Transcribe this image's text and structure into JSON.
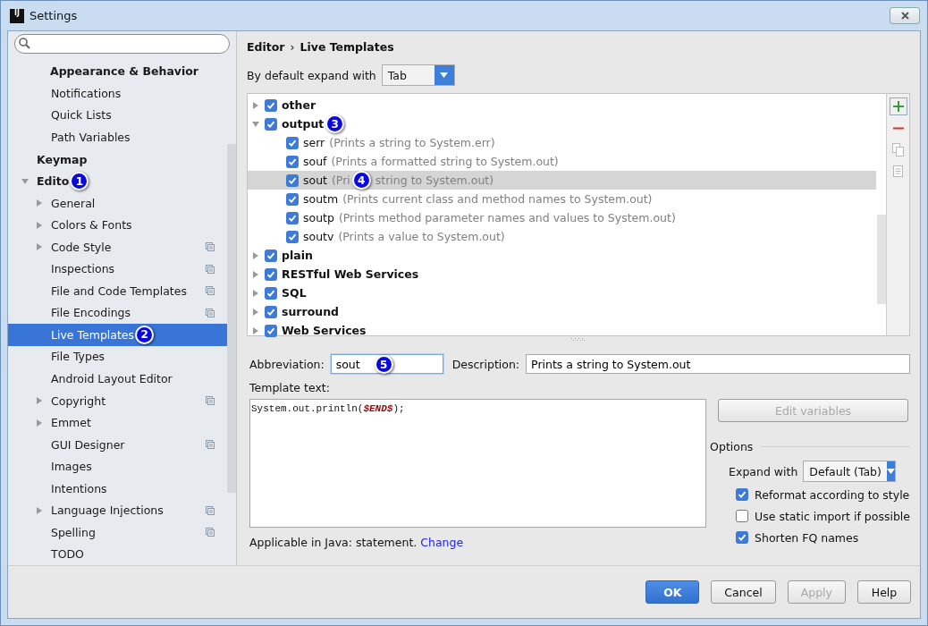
{
  "window": {
    "title": "Settings",
    "logo_text": "IJ"
  },
  "sidebar": {
    "items": [
      {
        "label": "Appearance & Behavior",
        "kind": "header",
        "selected": false,
        "children": [
          {
            "label": "Notifications",
            "selected": false
          },
          {
            "label": "Quick Lists",
            "selected": false
          },
          {
            "label": "Path Variables",
            "selected": false
          }
        ]
      },
      {
        "label": "Keymap",
        "kind": "top",
        "selected": false
      },
      {
        "label": "Edito",
        "kind": "top",
        "expanded": true,
        "callout": "1",
        "selected": false,
        "children": [
          {
            "label": "General",
            "expanded": false,
            "selected": false
          },
          {
            "label": "Colors & Fonts",
            "expanded": false,
            "selected": false
          },
          {
            "label": "Code Style",
            "expanded": false,
            "project": true,
            "selected": false
          },
          {
            "label": "Inspections",
            "project": true,
            "selected": false
          },
          {
            "label": "File and Code Templates",
            "project": true,
            "selected": false
          },
          {
            "label": "File Encodings",
            "project": true,
            "selected": false
          },
          {
            "label": "Live Templates",
            "callout": "2",
            "selected": true
          },
          {
            "label": "File Types",
            "selected": false
          },
          {
            "label": "Android Layout Editor",
            "selected": false
          },
          {
            "label": "Copyright",
            "expanded": false,
            "project": true,
            "selected": false
          },
          {
            "label": "Emmet",
            "expanded": false,
            "selected": false
          },
          {
            "label": "GUI Designer",
            "project": true,
            "selected": false
          },
          {
            "label": "Images",
            "selected": false
          },
          {
            "label": "Intentions",
            "selected": false
          },
          {
            "label": "Language Injections",
            "expanded": false,
            "project": true,
            "selected": false
          },
          {
            "label": "Spelling",
            "project": true,
            "selected": false
          },
          {
            "label": "TODO",
            "selected": false
          }
        ]
      }
    ]
  },
  "breadcrumb": [
    "Editor",
    "›",
    "Live Templates"
  ],
  "expand_default": {
    "label": "By default expand with",
    "value": "Tab"
  },
  "templates": [
    {
      "name": "other",
      "checked": true,
      "expanded": false
    },
    {
      "name": "output",
      "checked": true,
      "expanded": true,
      "callout": "3",
      "children": [
        {
          "name": "serr",
          "description": "(Prints a string to System.err)",
          "checked": true,
          "selected": false
        },
        {
          "name": "souf",
          "description": "(Prints a formatted string to System.out)",
          "checked": true,
          "selected": false
        },
        {
          "name": "sout",
          "description": "(Pri",
          "callout": "4",
          "description_after": "string to System.out)",
          "checked": true,
          "selected": true
        },
        {
          "name": "soutm",
          "description": "(Prints current class and method names to System.out)",
          "checked": true,
          "selected": false
        },
        {
          "name": "soutp",
          "description": "(Prints method parameter names and values to System.out)",
          "checked": true,
          "selected": false
        },
        {
          "name": "soutv",
          "description": "(Prints a value to System.out)",
          "checked": true,
          "selected": false
        }
      ]
    },
    {
      "name": "plain",
      "checked": true,
      "expanded": false
    },
    {
      "name": "RESTful Web Services",
      "checked": true,
      "expanded": false
    },
    {
      "name": "SQL",
      "checked": true,
      "expanded": false
    },
    {
      "name": "surround",
      "checked": true,
      "expanded": false
    },
    {
      "name": "Web Services",
      "checked": true,
      "expanded": false
    }
  ],
  "toolbar": [
    {
      "kind": "add",
      "disabled": false
    },
    {
      "kind": "remove",
      "disabled": false
    },
    {
      "kind": "copy",
      "disabled": true
    },
    {
      "kind": "page",
      "disabled": true
    }
  ],
  "abbreviation": {
    "label": "Abbreviation:",
    "value": "sout",
    "callout": "5"
  },
  "description": {
    "label": "Description:",
    "value": "Prints a string to System.out"
  },
  "template_text": {
    "label": "Template text:",
    "code": "System.out.println(**$END$**);"
  },
  "edit_variables": {
    "label": "Edit variables",
    "disabled": true
  },
  "options": {
    "title": "Options",
    "expand_with": {
      "label": "Expand with",
      "value": "Default (Tab)"
    },
    "checkboxes": [
      {
        "label": "Reformat according to style",
        "checked": true
      },
      {
        "label": "Use static import if possible",
        "checked": false
      },
      {
        "label": "Shorten FQ names",
        "checked": true
      }
    ]
  },
  "applicable": {
    "text": "Applicable in Java: statement.",
    "link": "Change"
  },
  "buttons": [
    {
      "label": "OK",
      "kind": "primary",
      "disabled": false
    },
    {
      "label": "Cancel",
      "kind": "normal",
      "disabled": false
    },
    {
      "label": "Apply",
      "kind": "normal",
      "disabled": true
    },
    {
      "label": "Help",
      "kind": "normal",
      "disabled": false
    }
  ]
}
